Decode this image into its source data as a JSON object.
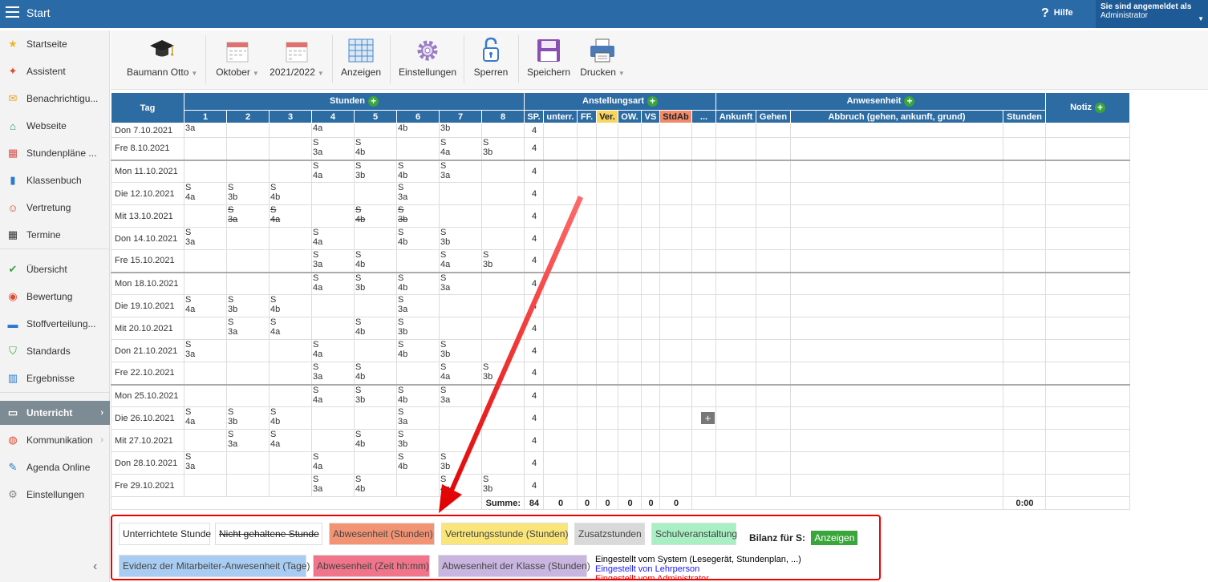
{
  "topbar": {
    "title": "Start",
    "help": "Hilfe",
    "logged_in_label": "Sie sind angemeldet als",
    "user": "Administrator"
  },
  "sidebar": {
    "items": [
      {
        "label": "Startseite",
        "icon": "star-icon",
        "color": "#f0b429"
      },
      {
        "label": "Assistent",
        "icon": "wand-icon",
        "color": "#e04a2f"
      },
      {
        "label": "Benachrichtigu...",
        "icon": "envelope-icon",
        "color": "#f0a020"
      },
      {
        "label": "Webseite",
        "icon": "home-icon",
        "color": "#1a9a7a"
      },
      {
        "label": "Stundenpläne ...",
        "icon": "grid-icon",
        "color": "#d9534f"
      },
      {
        "label": "Klassenbuch",
        "icon": "book-icon",
        "color": "#2a7ad2"
      },
      {
        "label": "Vertretung",
        "icon": "person-icon",
        "color": "#e04a2f"
      },
      {
        "label": "Termine",
        "icon": "calendar-icon",
        "color": "#333333"
      },
      {
        "label": "Übersicht",
        "icon": "check-circle-icon",
        "color": "#3aa53a"
      },
      {
        "label": "Bewertung",
        "icon": "chart-circle-icon",
        "color": "#e04a2f"
      },
      {
        "label": "Stoffverteilung...",
        "icon": "briefcase-icon",
        "color": "#2a7ad2"
      },
      {
        "label": "Standards",
        "icon": "shield-check-icon",
        "color": "#3aa53a"
      },
      {
        "label": "Ergebnisse",
        "icon": "bar-chart-icon",
        "color": "#2a7ad2"
      },
      {
        "label": "Unterricht",
        "icon": "open-book-icon",
        "color": "#ffffff"
      },
      {
        "label": "Kommunikation",
        "icon": "chat-icon",
        "color": "#e04a2f"
      },
      {
        "label": "Agenda Online",
        "icon": "pen-icon",
        "color": "#2a7ad2"
      },
      {
        "label": "Einstellungen",
        "icon": "gear-icon",
        "color": "#888888"
      }
    ]
  },
  "toolbar": {
    "teacher": "Baumann Otto",
    "month": "Oktober",
    "year": "2021/2022",
    "show": "Anzeigen",
    "settings": "Einstellungen",
    "lock": "Sperren",
    "save": "Speichern",
    "print": "Drucken"
  },
  "table": {
    "headers": {
      "tag": "Tag",
      "stunden": "Stunden",
      "anstellungsart": "Anstellungsart",
      "anwesenheit": "Anwesenheit",
      "notiz": "Notiz",
      "periods": [
        "1",
        "2",
        "3",
        "4",
        "5",
        "6",
        "7",
        "8"
      ],
      "sp": "SP.",
      "unterr": "unterr.",
      "ff": "FF.",
      "ver": "Ver.",
      "ow": "OW.",
      "vs": "VS",
      "stdab": "StdAb",
      "more": "...",
      "ankunft": "Ankunft",
      "gehen": "Gehen",
      "abbruch": "Abbruch (gehen, ankunft, grund)",
      "stunden_col": "Stunden"
    },
    "rows": [
      {
        "day": "Don 7.10.2021",
        "sp": "4",
        "first": true,
        "cells": [
          [
            "",
            "3a"
          ],
          null,
          null,
          [
            "4a"
          ],
          null,
          [
            "4b"
          ],
          [
            "3b"
          ],
          null
        ]
      },
      {
        "day": "Fre 8.10.2021",
        "sp": "4",
        "cells": [
          null,
          null,
          null,
          [
            "S",
            "3a"
          ],
          [
            "S",
            "4b"
          ],
          null,
          [
            "S",
            "4a"
          ],
          [
            "S",
            "3b"
          ]
        ]
      },
      {
        "day": "Mon 11.10.2021",
        "sp": "4",
        "weekstart": true,
        "cells": [
          null,
          null,
          null,
          [
            "S",
            "4a"
          ],
          [
            "S",
            "3b"
          ],
          [
            "S",
            "4b"
          ],
          [
            "S",
            "3a"
          ],
          null
        ]
      },
      {
        "day": "Die 12.10.2021",
        "sp": "4",
        "cells": [
          [
            "S",
            "4a"
          ],
          [
            "S",
            "3b"
          ],
          [
            "S",
            "4b"
          ],
          null,
          null,
          [
            "S",
            "3a"
          ],
          null,
          null
        ]
      },
      {
        "day": "Mit 13.10.2021",
        "sp": "4",
        "struck": true,
        "cells": [
          null,
          [
            "S",
            "3a"
          ],
          [
            "S",
            "4a"
          ],
          null,
          [
            "S",
            "4b"
          ],
          [
            "S",
            "3b"
          ],
          null,
          null
        ]
      },
      {
        "day": "Don 14.10.2021",
        "sp": "4",
        "cells": [
          [
            "S",
            "3a"
          ],
          null,
          null,
          [
            "S",
            "4a"
          ],
          null,
          [
            "S",
            "4b"
          ],
          [
            "S",
            "3b"
          ],
          null
        ]
      },
      {
        "day": "Fre 15.10.2021",
        "sp": "4",
        "cells": [
          null,
          null,
          null,
          [
            "S",
            "3a"
          ],
          [
            "S",
            "4b"
          ],
          null,
          [
            "S",
            "4a"
          ],
          [
            "S",
            "3b"
          ]
        ]
      },
      {
        "day": "Mon 18.10.2021",
        "sp": "4",
        "weekstart": true,
        "cells": [
          null,
          null,
          null,
          [
            "S",
            "4a"
          ],
          [
            "S",
            "3b"
          ],
          [
            "S",
            "4b"
          ],
          [
            "S",
            "3a"
          ],
          null
        ]
      },
      {
        "day": "Die 19.10.2021",
        "sp": "4",
        "cells": [
          [
            "S",
            "4a"
          ],
          [
            "S",
            "3b"
          ],
          [
            "S",
            "4b"
          ],
          null,
          null,
          [
            "S",
            "3a"
          ],
          null,
          null
        ]
      },
      {
        "day": "Mit 20.10.2021",
        "sp": "4",
        "cells": [
          null,
          [
            "S",
            "3a"
          ],
          [
            "S",
            "4a"
          ],
          null,
          [
            "S",
            "4b"
          ],
          [
            "S",
            "3b"
          ],
          null,
          null
        ]
      },
      {
        "day": "Don 21.10.2021",
        "sp": "4",
        "cells": [
          [
            "S",
            "3a"
          ],
          null,
          null,
          [
            "S",
            "4a"
          ],
          null,
          [
            "S",
            "4b"
          ],
          [
            "S",
            "3b"
          ],
          null
        ]
      },
      {
        "day": "Fre 22.10.2021",
        "sp": "4",
        "cells": [
          null,
          null,
          null,
          [
            "S",
            "3a"
          ],
          [
            "S",
            "4b"
          ],
          null,
          [
            "S",
            "4a"
          ],
          [
            "S",
            "3b"
          ]
        ]
      },
      {
        "day": "Mon 25.10.2021",
        "sp": "4",
        "weekstart": true,
        "cells": [
          null,
          null,
          null,
          [
            "S",
            "4a"
          ],
          [
            "S",
            "3b"
          ],
          [
            "S",
            "4b"
          ],
          [
            "S",
            "3a"
          ],
          null
        ]
      },
      {
        "day": "Die 26.10.2021",
        "sp": "4",
        "add": true,
        "cells": [
          [
            "S",
            "4a"
          ],
          [
            "S",
            "3b"
          ],
          [
            "S",
            "4b"
          ],
          null,
          null,
          [
            "S",
            "3a"
          ],
          null,
          null
        ]
      },
      {
        "day": "Mit 27.10.2021",
        "sp": "4",
        "cells": [
          null,
          [
            "S",
            "3a"
          ],
          [
            "S",
            "4a"
          ],
          null,
          [
            "S",
            "4b"
          ],
          [
            "S",
            "3b"
          ],
          null,
          null
        ]
      },
      {
        "day": "Don 28.10.2021",
        "sp": "4",
        "cells": [
          [
            "S",
            "3a"
          ],
          null,
          null,
          [
            "S",
            "4a"
          ],
          null,
          [
            "S",
            "4b"
          ],
          [
            "S",
            "3b"
          ],
          null
        ]
      },
      {
        "day": "Fre 29.10.2021",
        "sp": "4",
        "cells": [
          null,
          null,
          null,
          [
            "S",
            "3a"
          ],
          [
            "S",
            "4b"
          ],
          null,
          [
            "S",
            "4a"
          ],
          [
            "S",
            "3b"
          ]
        ]
      }
    ],
    "summe": {
      "label": "Summe:",
      "sp": "84",
      "unterr": "0",
      "ff": "0",
      "ver": "0",
      "ow": "0",
      "vs": "0",
      "stdab": "0",
      "stunden": "0:00"
    }
  },
  "legend": {
    "items": [
      {
        "label": "Unterrichtete Stunde",
        "bg": "#ffffff",
        "struck": false
      },
      {
        "label": "Nicht gehaltene Stunde",
        "bg": "#ffffff",
        "struck": true
      },
      {
        "label": "Abwesenheit (Stunden)",
        "bg": "#f29474",
        "struck": false
      },
      {
        "label": "Vertretungsstunde (Stunden)",
        "bg": "#f9e57a",
        "struck": false
      },
      {
        "label": "Zusatzstunden",
        "bg": "#d9d9d9",
        "struck": false
      },
      {
        "label": "Schulveranstaltung",
        "bg": "#a8f0c4",
        "struck": false
      },
      {
        "label": "Evidenz der Mitarbeiter-Anwesenheit (Tage)",
        "bg": "#a9cdf2",
        "struck": false
      },
      {
        "label": "Abwesenheit (Zeit hh:mm)",
        "bg": "#f0748a",
        "struck": false
      },
      {
        "label": "Abwesenheit der Klasse (Stunden)",
        "bg": "#c8b6e0",
        "struck": false
      }
    ],
    "bilanz_label": "Bilanz für S:",
    "bilanz_button": "Anzeigen",
    "info": [
      {
        "text": "Eingestellt vom System (Lesegerät, Stundenplan, ...)",
        "color": "#000000"
      },
      {
        "text": "Eingestellt von Lehrperson",
        "color": "#1a1aff"
      },
      {
        "text": "Eingestellt vom Administrator",
        "color": "#e00000"
      }
    ]
  }
}
